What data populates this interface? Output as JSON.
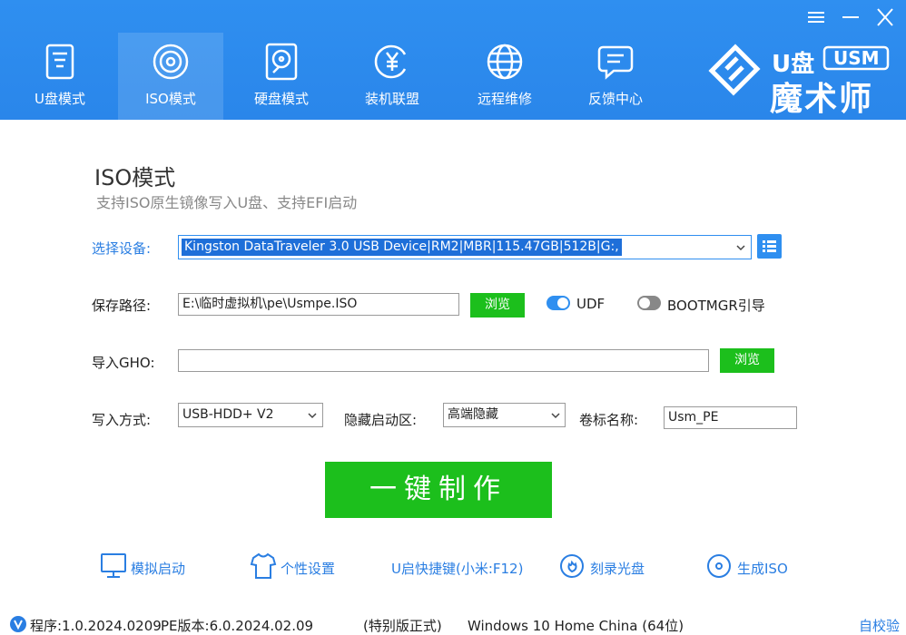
{
  "window": {
    "menu_icon": "menu-icon",
    "minimize_icon": "minimize-icon",
    "close_icon": "close-icon"
  },
  "nav": [
    {
      "label": "U盘模式",
      "icon": "usb-drive-icon"
    },
    {
      "label": "ISO模式",
      "icon": "disc-icon",
      "active": true
    },
    {
      "label": "硬盘模式",
      "icon": "hard-disk-icon"
    },
    {
      "label": "装机联盟",
      "icon": "yuan-coin-icon"
    },
    {
      "label": "远程维修",
      "icon": "globe-icon"
    },
    {
      "label": "反馈中心",
      "icon": "chat-icon"
    }
  ],
  "logo": {
    "text_top": "U盘",
    "badge": "USM",
    "text_bottom": "魔术师"
  },
  "page": {
    "title": "ISO模式",
    "subtitle": "支持ISO原生镜像写入U盘、支持EFI启动"
  },
  "device": {
    "label": "选择设备:",
    "value": "Kingston DataTraveler 3.0 USB Device|RM2|MBR|115.47GB|512B|G:,"
  },
  "save_path": {
    "label": "保存路径:",
    "value": "E:\\临时虚拟机\\pe\\Usmpe.ISO",
    "browse": "浏览"
  },
  "udf": {
    "label": "UDF",
    "on": true
  },
  "bootmgr": {
    "label": "BOOTMGR引导",
    "on": false
  },
  "gho": {
    "label": "导入GHO:",
    "value": "",
    "browse": "浏览"
  },
  "write_mode": {
    "label": "写入方式:",
    "value": "USB-HDD+ V2"
  },
  "hidden_boot": {
    "label": "隐藏启动区:",
    "value": "高端隐藏"
  },
  "volume": {
    "label": "卷标名称:",
    "value": "Usm_PE"
  },
  "make_button": "一键制作",
  "tools": [
    {
      "label": "模拟启动",
      "icon": "monitor-icon"
    },
    {
      "label": "个性设置",
      "icon": "tshirt-icon"
    },
    {
      "label": "U启快捷键(小米:F12)"
    },
    {
      "label": "刻录光盘",
      "icon": "burn-disc-icon"
    },
    {
      "label": "生成ISO",
      "icon": "iso-disc-icon"
    }
  ],
  "status": {
    "program": "程序:1.0.2024.0209",
    "pe_version": "PE版本:6.0.2024.02.09",
    "edition": "(特别版正式)",
    "os": "Windows 10 Home China (64位)",
    "check": "自校验"
  },
  "colors": {
    "header": "#2a86ea",
    "green": "#1cbf1c",
    "link_blue": "#2a7ee2"
  }
}
